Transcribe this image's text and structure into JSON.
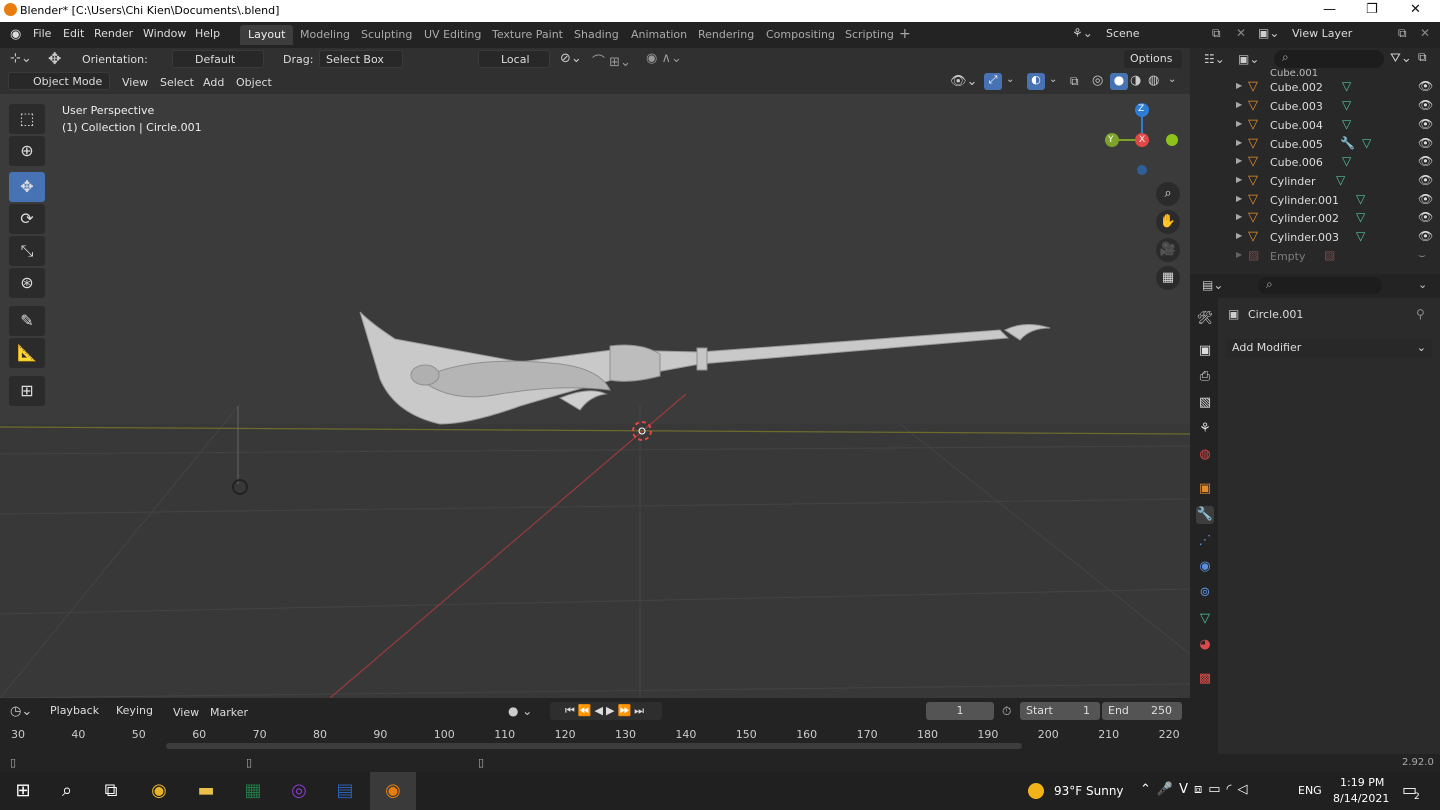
{
  "window": {
    "title": "Blender* [C:\\Users\\Chi Kien\\Documents\\.blend]",
    "minimize": "—",
    "maximize": "❐",
    "close": "✕"
  },
  "menu": [
    "File",
    "Edit",
    "Render",
    "Window",
    "Help"
  ],
  "workspaces": [
    "Layout",
    "Modeling",
    "Sculpting",
    "UV Editing",
    "Texture Paint",
    "Shading",
    "Animation",
    "Rendering",
    "Compositing",
    "Scripting"
  ],
  "scene": {
    "label": "Scene",
    "view_layer": "View Layer"
  },
  "toolbar": {
    "orientation_label": "Orientation:",
    "orientation_value": "Default",
    "drag_label": "Drag:",
    "drag_value": "Select Box",
    "pivot_value": "Local",
    "options": "Options"
  },
  "viewport_header": {
    "mode": "Object Mode",
    "view": "View",
    "select": "Select",
    "add": "Add",
    "object": "Object"
  },
  "viewport": {
    "perspective": "User Perspective",
    "collection": "(1) Collection | Circle.001"
  },
  "outliner": {
    "partial_top": "Cube.001",
    "items": [
      "Cube.002",
      "Cube.003",
      "Cube.004",
      "Cube.005",
      "Cube.006",
      "Cylinder",
      "Cylinder.001",
      "Cylinder.002",
      "Cylinder.003"
    ],
    "empty": "Empty"
  },
  "properties": {
    "object_name": "Circle.001",
    "add_modifier": "Add Modifier"
  },
  "timeline": {
    "playback": "Playback",
    "keying": "Keying",
    "view": "View",
    "marker": "Marker",
    "current_frame": "1",
    "start_label": "Start",
    "start_value": "1",
    "end_label": "End",
    "end_value": "250",
    "ticks": [
      "30",
      "40",
      "50",
      "60",
      "70",
      "80",
      "90",
      "100",
      "110",
      "120",
      "130",
      "140",
      "150",
      "160",
      "170",
      "180",
      "190",
      "200",
      "210",
      "220"
    ]
  },
  "status": {
    "version": "2.92.0"
  },
  "taskbar": {
    "weather": "93°F  Sunny",
    "lang": "ENG",
    "time": "1:19 PM",
    "date": "8/14/2021",
    "notif_count": "2"
  },
  "colors": {
    "accent": "#4772b3",
    "orange": "#e38b2c",
    "mesh_green": "#4fc4a0"
  }
}
